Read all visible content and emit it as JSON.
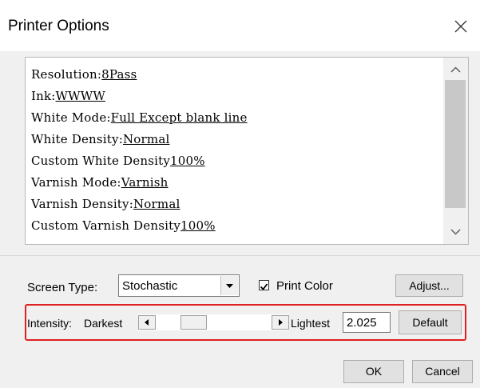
{
  "window": {
    "title": "Printer Options",
    "close_icon": "close-icon"
  },
  "settings_list": {
    "items": [
      {
        "label": "Resolution:",
        "value": "8Pass"
      },
      {
        "label": "Ink:",
        "value": "WWWW"
      },
      {
        "label": "White Mode:",
        "value": "Full Except blank line"
      },
      {
        "label": "White Density:",
        "value": "Normal"
      },
      {
        "label": "Custom White Density",
        "value": "100%"
      },
      {
        "label": "Varnish Mode:",
        "value": "Varnish"
      },
      {
        "label": "Varnish Density:",
        "value": "Normal"
      },
      {
        "label": "Custom Varnish Density",
        "value": "100%"
      }
    ]
  },
  "screen_type": {
    "label": "Screen Type:",
    "selected": "Stochastic"
  },
  "print_color": {
    "label": "Print Color",
    "checked": true
  },
  "adjust_button": "Adjust...",
  "intensity": {
    "label": "Intensity:",
    "min_label": "Darkest",
    "max_label": "Lightest",
    "value": "2.025",
    "default_button": "Default",
    "highlight_color": "#e02020"
  },
  "footer": {
    "ok": "OK",
    "cancel": "Cancel"
  }
}
